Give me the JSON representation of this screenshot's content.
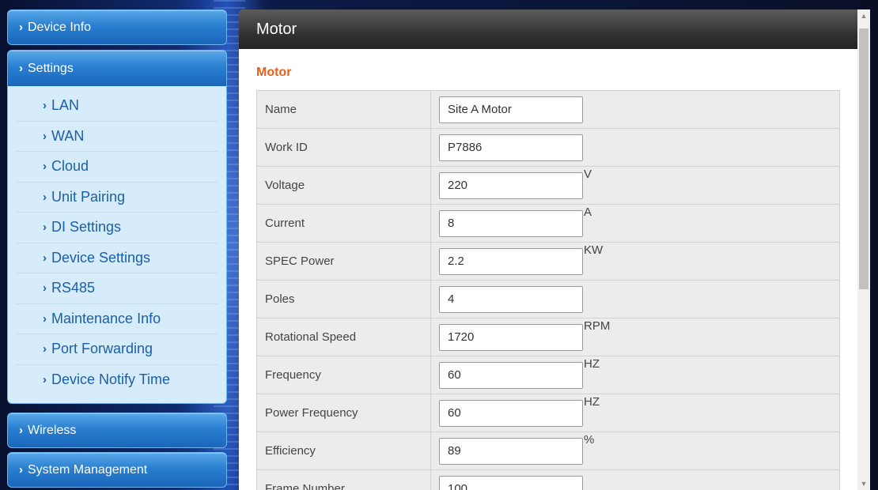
{
  "sidebar": {
    "device_info": "Device Info",
    "settings": "Settings",
    "submenu": [
      {
        "label": "LAN"
      },
      {
        "label": "WAN"
      },
      {
        "label": "Cloud"
      },
      {
        "label": "Unit Pairing"
      },
      {
        "label": "DI Settings"
      },
      {
        "label": "Device Settings"
      },
      {
        "label": "RS485"
      },
      {
        "label": "Maintenance Info"
      },
      {
        "label": "Port Forwarding"
      },
      {
        "label": "Device Notify Time"
      }
    ],
    "wireless": "Wireless",
    "system_management": "System Management"
  },
  "panel": {
    "header": "Motor",
    "section_title": "Motor"
  },
  "form": {
    "rows": [
      {
        "label": "Name",
        "value": "Site A Motor",
        "unit": ""
      },
      {
        "label": "Work ID",
        "value": "P7886",
        "unit": ""
      },
      {
        "label": "Voltage",
        "value": "220",
        "unit": "V"
      },
      {
        "label": "Current",
        "value": "8",
        "unit": "A"
      },
      {
        "label": "SPEC Power",
        "value": "2.2",
        "unit": "KW"
      },
      {
        "label": "Poles",
        "value": "4",
        "unit": ""
      },
      {
        "label": "Rotational Speed",
        "value": "1720",
        "unit": "RPM"
      },
      {
        "label": "Frequency",
        "value": "60",
        "unit": "HZ"
      },
      {
        "label": "Power Frequency",
        "value": "60",
        "unit": "HZ"
      },
      {
        "label": "Efficiency",
        "value": "89",
        "unit": "%"
      },
      {
        "label": "Frame Number",
        "value": "100",
        "unit": ""
      }
    ]
  },
  "icons": {
    "chevron": "chevron-right-icon",
    "scroll_up": "scroll-up-arrow-icon",
    "scroll_down": "scroll-down-arrow-icon"
  },
  "colors": {
    "section_title": "#e8601c",
    "menu_blue": "#2a7fd0",
    "submenu_text": "#1b5fa8"
  }
}
